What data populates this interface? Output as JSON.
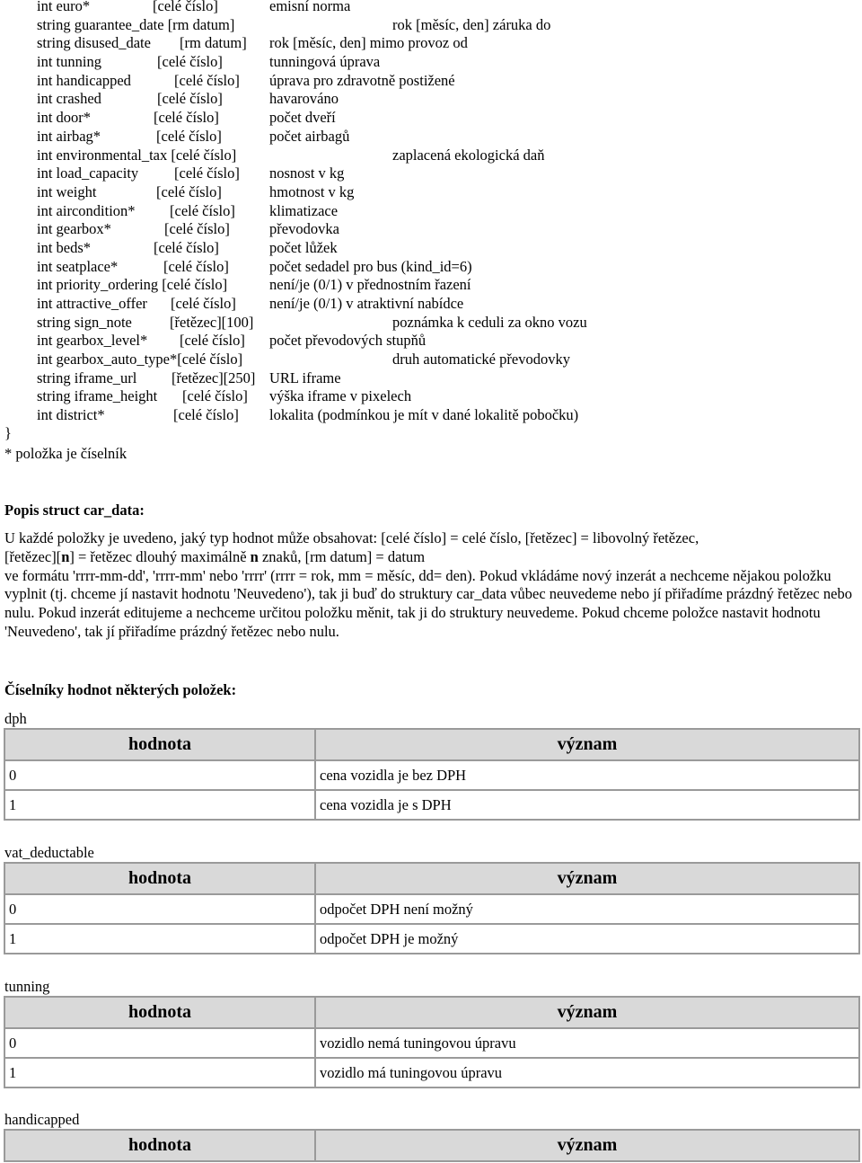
{
  "struct_lines": [
    {
      "decl": "int euro*",
      "type": "[celé číslo]",
      "desc": "emisní norma",
      "tpos": 170,
      "dpos": 300
    },
    {
      "decl": "string guarantee_date [rm datum]",
      "type": "",
      "desc": "rok [měsíc, den]  záruka do",
      "tpos": 0,
      "dpos": 437
    },
    {
      "decl": "string disused_date",
      "type": "[rm datum]",
      "desc": "rok [měsíc, den]  mimo provoz od",
      "tpos": 200,
      "dpos": 300
    },
    {
      "decl": "int tunning",
      "type": "[celé číslo]",
      "desc": "tunningová úprava",
      "tpos": 175,
      "dpos": 300
    },
    {
      "decl": "int handicapped",
      "type": "[celé číslo]",
      "desc": "úprava pro zdravotně postižené",
      "tpos": 194,
      "dpos": 300
    },
    {
      "decl": "int crashed",
      "type": "[celé číslo]",
      "desc": "havarováno",
      "tpos": 175,
      "dpos": 300
    },
    {
      "decl": "int door*",
      "type": "[celé číslo]",
      "desc": "počet dveří",
      "tpos": 171,
      "dpos": 300
    },
    {
      "decl": "int airbag*",
      "type": "[celé číslo]",
      "desc": "počet airbagů",
      "tpos": 174,
      "dpos": 300
    },
    {
      "decl": "int environmental_tax [celé číslo]",
      "type": "",
      "desc": "zaplacená ekologická daň",
      "tpos": 0,
      "dpos": 437
    },
    {
      "decl": "int load_capacity",
      "type": "[celé číslo]",
      "desc": "nosnost v kg",
      "tpos": 194,
      "dpos": 300
    },
    {
      "decl": "int weight",
      "type": "[celé číslo]",
      "desc": "hmotnost v kg",
      "tpos": 174,
      "dpos": 300
    },
    {
      "decl": "int aircondition*",
      "type": "[celé číslo]",
      "desc": "klimatizace",
      "tpos": 189,
      "dpos": 300
    },
    {
      "decl": "int gearbox*",
      "type": "[celé číslo]",
      "desc": "převodovka",
      "tpos": 183,
      "dpos": 300
    },
    {
      "decl": "int beds*",
      "type": "[celé číslo]",
      "desc": "počet lůžek",
      "tpos": 171,
      "dpos": 300
    },
    {
      "decl": "int seatplace*",
      "type": "[celé číslo]",
      "desc": "počet sedadel pro bus (kind_id=6)",
      "tpos": 182,
      "dpos": 300
    },
    {
      "decl": "int priority_ordering [celé číslo]",
      "type": "",
      "desc": "není/je (0/1) v přednostním řazení",
      "tpos": 0,
      "dpos": 300
    },
    {
      "decl": "int attractive_offer",
      "type": "[celé číslo]",
      "desc": "není/je (0/1) v atraktivní nabídce",
      "tpos": 190,
      "dpos": 300
    },
    {
      "decl": "string sign_note",
      "type": "[řetězec][100]",
      "desc": "poznámka k ceduli za okno vozu",
      "tpos": 189,
      "dpos": 437
    },
    {
      "decl": "int gearbox_level*",
      "type": "[celé číslo]",
      "desc": "počet převodových stupňů",
      "tpos": 200,
      "dpos": 300
    },
    {
      "decl": "int gearbox_auto_type*[celé číslo]",
      "type": "",
      "desc": "druh automatické převodovky",
      "tpos": 0,
      "dpos": 437
    },
    {
      "decl": "string iframe_url",
      "type": "[řetězec][250]",
      "desc": "URL iframe",
      "tpos": 191,
      "dpos": 300
    },
    {
      "decl": "string iframe_height",
      "type": "[celé číslo]",
      "desc": "výška iframe v pixelech",
      "tpos": 203,
      "dpos": 300
    },
    {
      "decl": "int district*",
      "type": "[celé číslo]",
      "desc": "lokalita (podmínkou je mít v dané lokalitě pobočku)",
      "tpos": 193,
      "dpos": 300
    }
  ],
  "closing_brace": "}",
  "footnote": "* položka je číselník",
  "description": {
    "heading": "Popis struct car_data:",
    "p1_a": "U každé položky je uvedeno, jaký typ hodnot může obsahovat: [celé číslo] = celé číslo, [řetězec] = libovolný řetězec,",
    "p1_b1": "[řetězec][",
    "p1_bold_n": "n",
    "p1_b2": "] = řetězec dlouhý maximálně ",
    "p1_bold_n2": "n",
    "p1_b3": " znaků, [rm datum] = datum",
    "p2": "ve formátu 'rrrr-mm-dd', 'rrrr-mm' nebo 'rrrr' (rrrr = rok, mm = měsíc, dd= den). Pokud vkládáme nový inzerát a nechceme nějakou položku vyplnit (tj. chceme jí nastavit hodnotu 'Neuvedeno'), tak ji buď do struktury car_data vůbec neuvedeme nebo jí přiřadíme prázdný řetězec nebo nulu. Pokud inzerát editujeme a nechceme určitou položku měnit, tak ji do struktury neuvedeme. Pokud chceme položce nastavit hodnotu 'Neuvedeno', tak jí přiřadíme prázdný řetězec nebo nulu."
  },
  "enums_heading": "Číselníky hodnot některých položek:",
  "enums": [
    {
      "name": "dph",
      "headers": [
        "hodnota",
        "význam"
      ],
      "rows": [
        [
          "0",
          "cena vozidla je bez DPH"
        ],
        [
          "1",
          "cena vozidla je s DPH"
        ]
      ]
    },
    {
      "name": "vat_deductable",
      "headers": [
        "hodnota",
        "význam"
      ],
      "rows": [
        [
          "0",
          "odpočet DPH není možný"
        ],
        [
          "1",
          "odpočet DPH je možný"
        ]
      ]
    },
    {
      "name": "tunning",
      "headers": [
        "hodnota",
        "význam"
      ],
      "rows": [
        [
          "0",
          "vozidlo nemá tuningovou úpravu"
        ],
        [
          "1",
          "vozidlo má tuningovou úpravu"
        ]
      ]
    },
    {
      "name": "handicapped",
      "headers": [
        "hodnota",
        "význam"
      ],
      "rows": []
    }
  ]
}
